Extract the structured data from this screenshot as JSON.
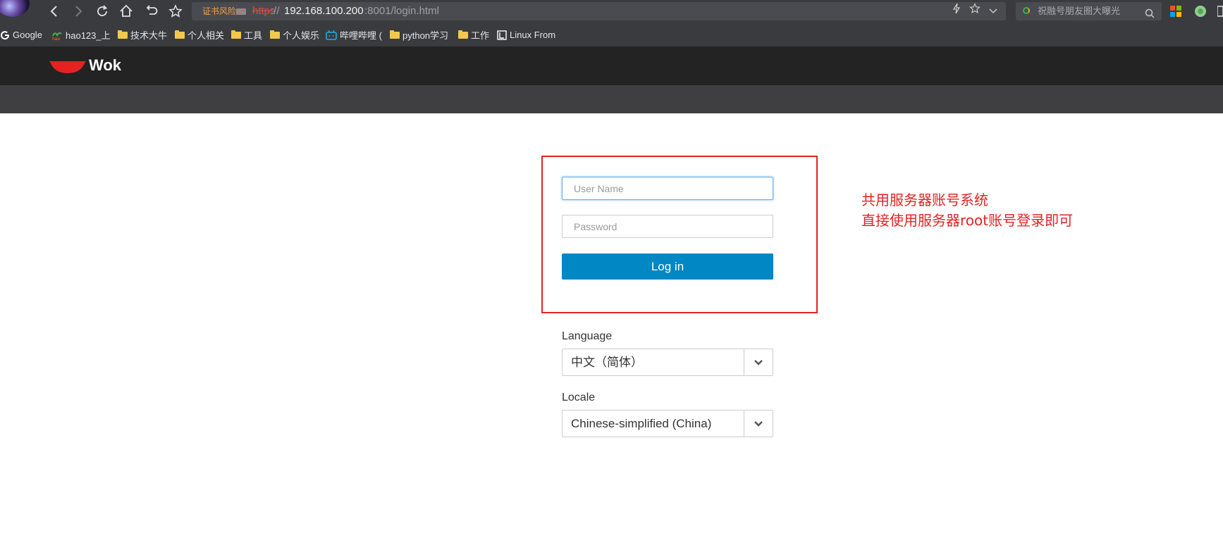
{
  "browser": {
    "cert_warning": "证书风险",
    "url_scheme": "https",
    "url_sep": "://",
    "url_host": "192.168.100.200",
    "url_rest": ":8001/login.html",
    "search_placeholder": "祝融号朋友圈大曝光",
    "bookmarks": [
      {
        "label": "Google",
        "icon": "google-icon"
      },
      {
        "label": "hao123_上",
        "icon": "hao123-icon"
      },
      {
        "label": "技术大牛",
        "icon": "folder-icon"
      },
      {
        "label": "个人相关",
        "icon": "folder-icon"
      },
      {
        "label": "工具",
        "icon": "folder-icon"
      },
      {
        "label": "个人娱乐",
        "icon": "folder-icon"
      },
      {
        "label": "哔哩哔哩 (",
        "icon": "bilibili-icon"
      },
      {
        "label": "python学习",
        "icon": "folder-icon"
      },
      {
        "label": "工作",
        "icon": "folder-icon"
      },
      {
        "label": "Linux From",
        "icon": "linux-icon"
      }
    ]
  },
  "app": {
    "title": "Wok",
    "logo_color": "#e52222"
  },
  "login": {
    "username_placeholder": "User Name",
    "password_placeholder": "Password",
    "login_button": "Log in",
    "language_label": "Language",
    "language_value": "中文（简体）",
    "locale_label": "Locale",
    "locale_value": "Chinese-simplified (China)",
    "accent_color": "#0187c4"
  },
  "annotation": {
    "line1": "共用服务器账号系统",
    "line2": "直接使用服务器root账号登录即可",
    "color": "#e52222"
  }
}
